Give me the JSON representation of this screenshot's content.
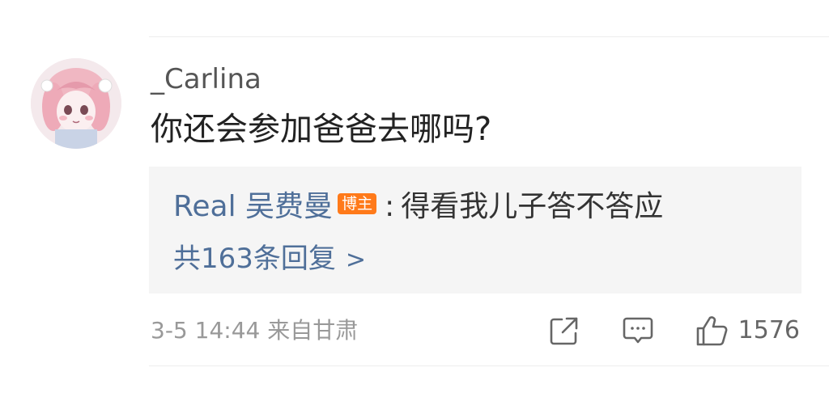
{
  "comment": {
    "username": "_Carlina",
    "text": "你还会参加爸爸去哪吗?",
    "avatar_icon": "anime-girl-avatar",
    "reply": {
      "author": "Real 吴费曼",
      "badge": "博主",
      "separator": ":",
      "text": "得看我儿子答不答应",
      "count_label": "共163条回复",
      "chevron": ">"
    },
    "meta": "3-5 14:44  来自甘肃",
    "actions": {
      "share_icon": "share-icon",
      "comment_icon": "comment-icon",
      "like_icon": "thumbs-up-icon",
      "like_count": "1576"
    }
  },
  "colors": {
    "link_blue": "#4f6f99",
    "badge_orange": "#ff7a1a",
    "reply_bg": "#f5f5f5",
    "meta_gray": "#999999"
  }
}
